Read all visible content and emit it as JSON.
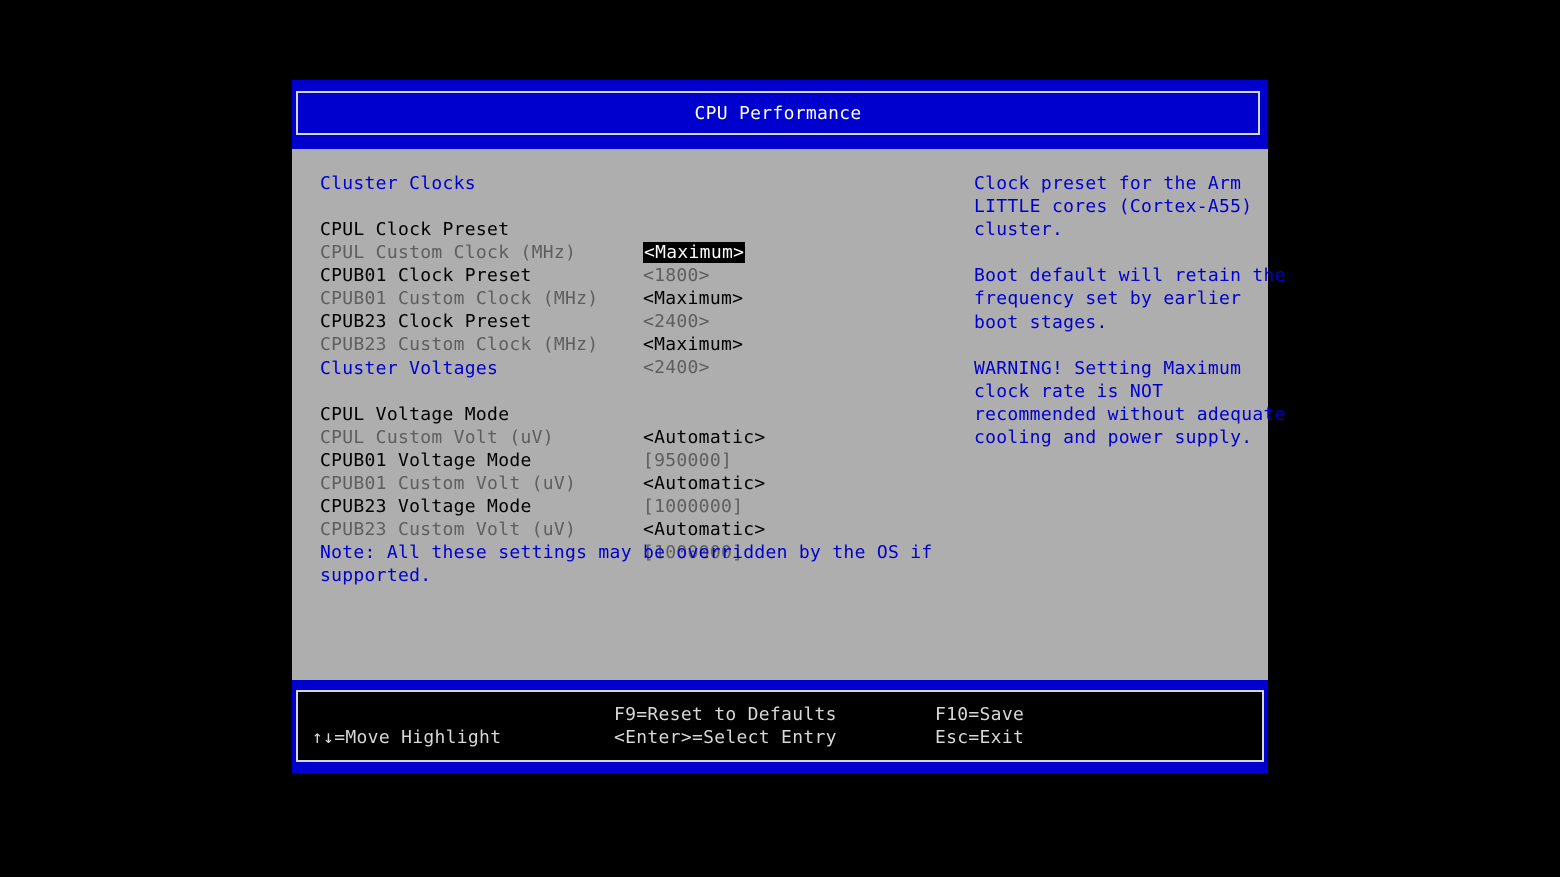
{
  "title": "CPU Performance",
  "colors": {
    "background": "#000000",
    "frame_blue": "#0000ce",
    "panel_gray": "#aeaeae",
    "heading_blue": "#0000ce",
    "inactive_gray": "#5e5e5e",
    "footer_text": "#d8d8d8"
  },
  "sections": [
    {
      "heading": "Cluster Clocks",
      "items": [
        {
          "label": "CPUL Clock Preset",
          "value": "<Maximum>",
          "state": "active",
          "selected": true
        },
        {
          "label": "CPUL Custom Clock (MHz)",
          "value": "<1800>",
          "state": "inactive"
        },
        {
          "label": "CPUB01 Clock Preset",
          "value": "<Maximum>",
          "state": "active"
        },
        {
          "label": "CPUB01 Custom Clock (MHz)",
          "value": "<2400>",
          "state": "inactive"
        },
        {
          "label": "CPUB23 Clock Preset",
          "value": "<Maximum>",
          "state": "active"
        },
        {
          "label": "CPUB23 Custom Clock (MHz)",
          "value": "<2400>",
          "state": "inactive"
        }
      ]
    },
    {
      "heading": "Cluster Voltages",
      "items": [
        {
          "label": "CPUL Voltage Mode",
          "value": "<Automatic>",
          "state": "active"
        },
        {
          "label": "CPUL Custom Volt (uV)",
          "value": "[950000]",
          "state": "inactive"
        },
        {
          "label": "CPUB01 Voltage Mode",
          "value": "<Automatic>",
          "state": "active"
        },
        {
          "label": "CPUB01 Custom Volt (uV)",
          "value": "[1000000]",
          "state": "inactive"
        },
        {
          "label": "CPUB23 Voltage Mode",
          "value": "<Automatic>",
          "state": "active"
        },
        {
          "label": "CPUB23 Custom Volt (uV)",
          "value": "[1000000]",
          "state": "inactive"
        }
      ]
    }
  ],
  "note": "Note: All these settings may be overridden by the OS if\nsupported.",
  "help": "Clock preset for the Arm\nLITTLE cores (Cortex-A55)\ncluster.\n\nBoot default will retain the\nfrequency set by earlier\nboot stages.\n\nWARNING! Setting Maximum\nclock rate is NOT\nrecommended without adequate\ncooling and power supply.",
  "footer": {
    "move": "↑↓=Move Highlight",
    "reset": "F9=Reset to Defaults",
    "select": "<Enter>=Select Entry",
    "save": "F10=Save",
    "exit": "Esc=Exit"
  }
}
